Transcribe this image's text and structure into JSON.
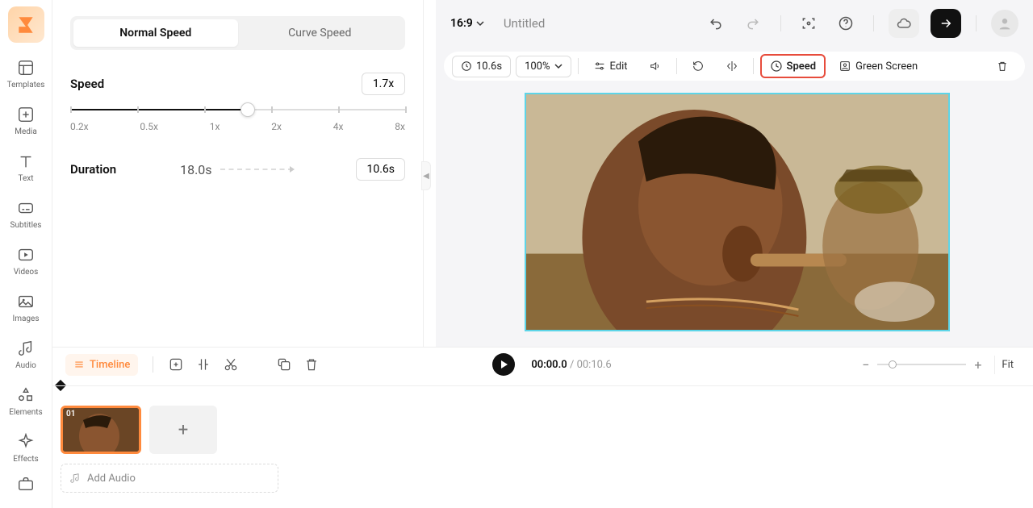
{
  "sidebar": {
    "items": [
      {
        "label": "Templates"
      },
      {
        "label": "Media"
      },
      {
        "label": "Text"
      },
      {
        "label": "Subtitles"
      },
      {
        "label": "Videos"
      },
      {
        "label": "Images"
      },
      {
        "label": "Audio"
      },
      {
        "label": "Elements"
      },
      {
        "label": "Effects"
      }
    ]
  },
  "speedPanel": {
    "tabNormal": "Normal Speed",
    "tabCurve": "Curve Speed",
    "speedLabel": "Speed",
    "speedValue": "1.7x",
    "ticks": [
      "0.2x",
      "0.5x",
      "1x",
      "2x",
      "4x",
      "8x"
    ],
    "durationLabel": "Duration",
    "durationFrom": "18.0s",
    "durationTo": "10.6s"
  },
  "header": {
    "aspect": "16:9",
    "title": "Untitled"
  },
  "toolbar": {
    "time": "10.6s",
    "zoom": "100%",
    "edit": "Edit",
    "speed": "Speed",
    "greenScreen": "Green Screen"
  },
  "timeline": {
    "label": "Timeline",
    "currentTime": "00:00.0",
    "totalTime": "00:10.6",
    "fit": "Fit",
    "clipNum": "01",
    "addAudio": "Add Audio"
  }
}
